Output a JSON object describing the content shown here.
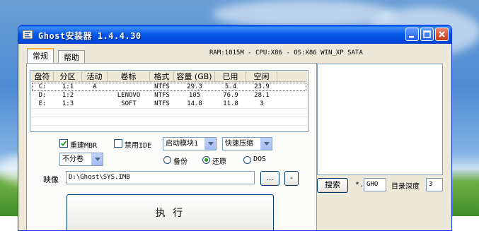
{
  "window": {
    "title": "Ghost安装器 1.4.4.30"
  },
  "tabs": [
    {
      "label": "常规"
    },
    {
      "label": "帮助"
    }
  ],
  "sysinfo": "RAM:1015M - CPU:X86 - OS:X86 WIN_XP SATA",
  "partitions": {
    "headers": [
      "盘符",
      "分区",
      "活动",
      "卷标",
      "格式",
      "容量 (GB)",
      "已用",
      "空闲"
    ],
    "rows": [
      [
        "C:",
        "1:1",
        "A",
        "",
        "NTFS",
        "29.3",
        "5.4",
        "23.9"
      ],
      [
        "D:",
        "1:2",
        "",
        "LENOVO",
        "NTFS",
        "105",
        "76.9",
        "28.1"
      ],
      [
        "E:",
        "1:3",
        "",
        "SOFT",
        "NTFS",
        "14.8",
        "11.8",
        "3"
      ]
    ]
  },
  "options": {
    "rebuild_mbr": {
      "label": "重建MBR",
      "checked": true
    },
    "disable_ide": {
      "label": "禁用IDE",
      "checked": false
    },
    "boot_module": "启动模块1",
    "compression": "快速压缩",
    "split": "不分卷",
    "mode_backup": "备份",
    "mode_restore": "还原",
    "mode_dos": "DOS",
    "selected_mode": "还原"
  },
  "image": {
    "label": "映像",
    "path": "D:\\Ghost\\SYS.IMB",
    "browse_label": "...",
    "minus_label": "-"
  },
  "execute_label": "执  行",
  "search": {
    "button_label": "搜索",
    "star": "*.",
    "ext": "GHO",
    "depth_label": "目录深度",
    "depth": "3"
  },
  "colors": {
    "title_bar": "#0454e9",
    "window_bg": "#ece9d8",
    "close_button": "#c53a16"
  }
}
